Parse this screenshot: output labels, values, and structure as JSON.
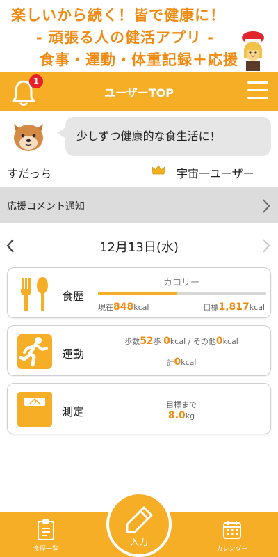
{
  "promo": {
    "line1": "楽しいから続く！皆で健康に！",
    "line2": "- 頑張る人の健活アプリ -",
    "line3": "食事・運動・体重記録＋応援"
  },
  "header": {
    "title": "ユーザーTOP",
    "notification_count": "1"
  },
  "profile": {
    "message": "少しずつ健康的な食生活に！",
    "username": "すだっち",
    "rank": "宇宙一ユーザー"
  },
  "notice": {
    "label": "応援コメント通知"
  },
  "date": {
    "label": "12月13日(水)"
  },
  "meal": {
    "title": "食歴",
    "calorie_label": "カロリー",
    "current_prefix": "現在",
    "current_value": "848",
    "current_unit": "kcal",
    "target_prefix": "目標",
    "target_value": "1,817",
    "target_unit": "kcal",
    "progress_fraction": 0.47
  },
  "exercise": {
    "title": "運動",
    "steps_prefix": "歩数",
    "steps_value": "52",
    "steps_unit": "歩",
    "steps_kcal_value": "0",
    "steps_kcal_unit": "kcal / その他",
    "other_value": "0",
    "other_unit": "kcal",
    "total_prefix": "計",
    "total_value": "0",
    "total_unit": "kcal"
  },
  "measure": {
    "title": "測定",
    "goal_label": "目標まで",
    "goal_value": "8.0",
    "goal_unit": "kg"
  },
  "bottom_nav": {
    "left_label": "食歴一覧",
    "center_label": "入力",
    "right_label": "カレンダー"
  },
  "colors": {
    "brand_orange": "#f5ae25",
    "accent_text": "#f08a12",
    "badge_red": "#e8202a"
  },
  "icons": {
    "bell": "bell-icon",
    "menu": "hamburger-menu-icon",
    "meal": "fork-spoon-icon",
    "exercise": "running-person-icon",
    "measure": "scale-icon",
    "list": "clipboard-list-icon",
    "calendar": "calendar-icon",
    "pencil": "pencil-icon"
  }
}
